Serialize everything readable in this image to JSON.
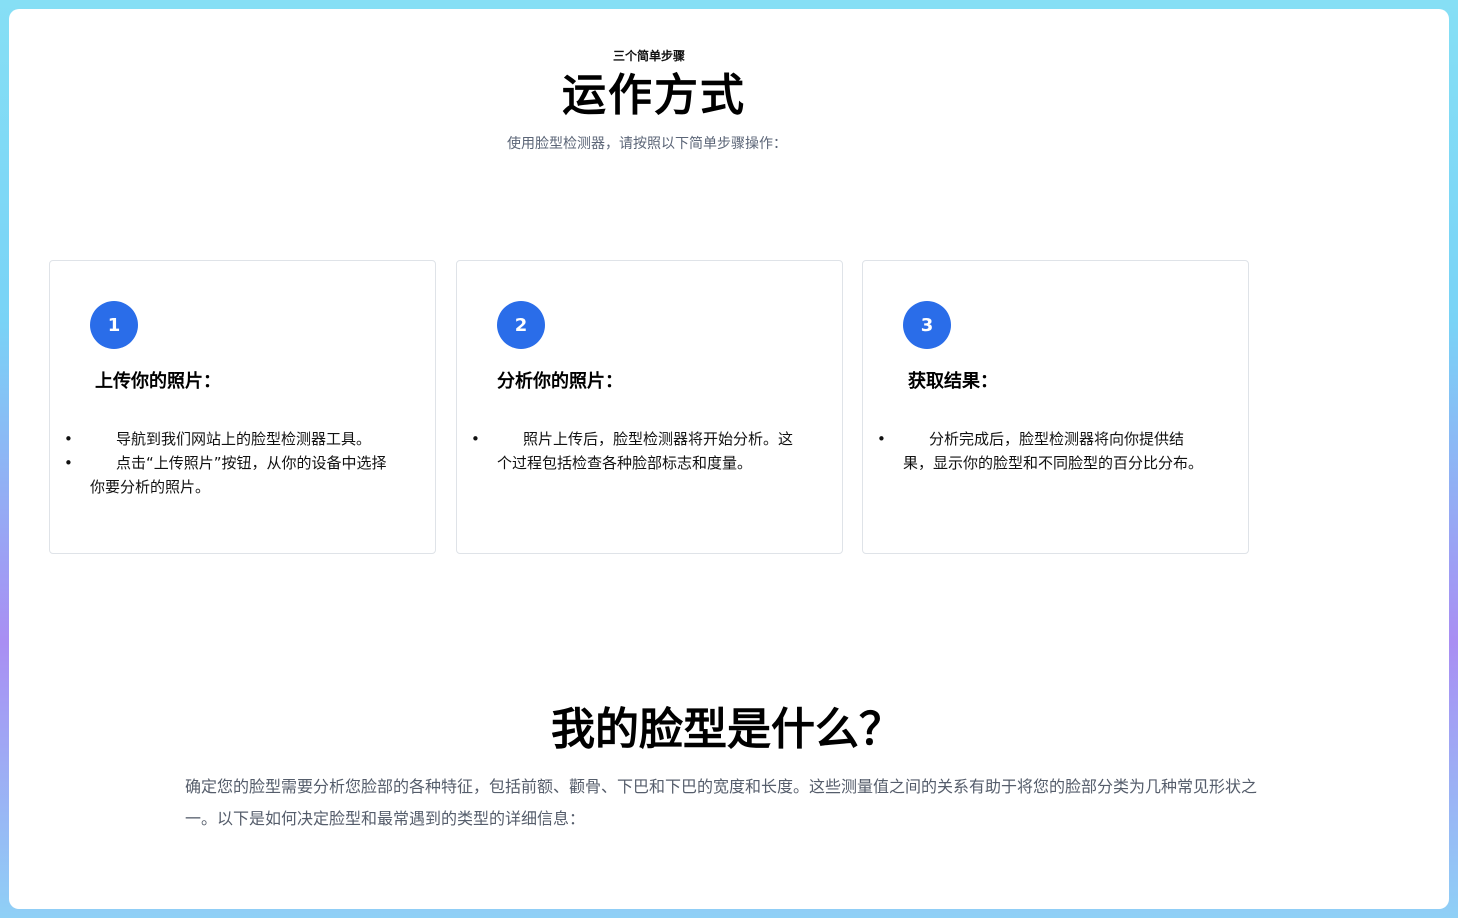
{
  "hero": {
    "eyebrow": "三个简单步骤",
    "title": "运作方式",
    "subtitle": "使用脸型检测器，请按照以下简单步骤操作："
  },
  "steps": [
    {
      "number": "1",
      "title": "上传你的照片：",
      "items": [
        "导航到我们网站上的脸型检测器工具。",
        "点击“上传照片”按钮，从你的设备中选择你要分析的照片。"
      ]
    },
    {
      "number": "2",
      "title": "分析你的照片：",
      "items": [
        "照片上传后，脸型检测器将开始分析。这个过程包括检查各种脸部标志和度量。"
      ]
    },
    {
      "number": "3",
      "title": "获取结果：",
      "items": [
        "分析完成后，脸型检测器将向你提供结果，显示你的脸型和不同脸型的百分比分布。"
      ]
    }
  ],
  "section": {
    "title": "我的脸型是什么？",
    "body": "确定您的脸型需要分析您脸部的各种特征，包括前额、颧骨、下巴和下巴的宽度和长度。这些测量值之间的关系有助于将您的脸部分类为几种常见形状之一。以下是如何决定脸型和最常遇到的类型的详细信息："
  },
  "colors": {
    "accent": "#2a6de9",
    "panel": "#ffffff",
    "card_border": "#dfe3e8"
  }
}
